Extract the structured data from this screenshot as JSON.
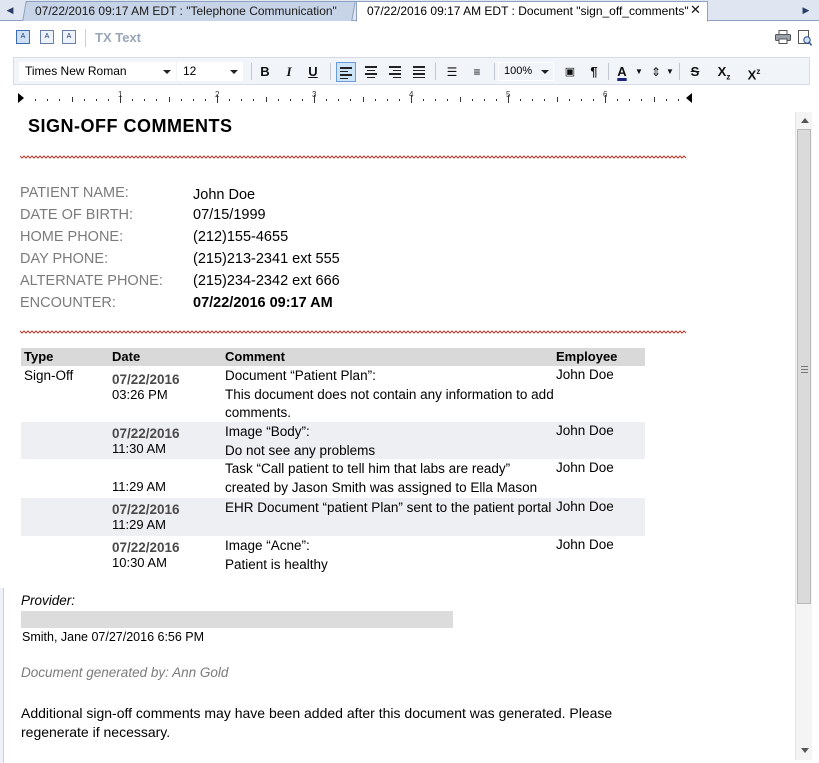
{
  "tabs": [
    {
      "label": "07/22/2016 09:17 AM EDT : \"Telephone Communication\"",
      "active": false
    },
    {
      "label": "07/22/2016 09:17 AM EDT : Document \"sign_off_comments\"",
      "active": true
    }
  ],
  "toolbar": {
    "product_label": "TX Text"
  },
  "format": {
    "font_family": "Times New Roman",
    "font_size": "12",
    "zoom": "100%",
    "bold": "B",
    "italic": "I",
    "underline": "U",
    "pilcrow": "¶",
    "strike": "S",
    "subscript": "X",
    "subscript_mark": "z",
    "superscript": "X",
    "superscript_mark": "z"
  },
  "ruler": {
    "numbers": [
      "1",
      "2",
      "3",
      "4",
      "5",
      "6"
    ]
  },
  "document": {
    "title": "SIGN-OFF COMMENTS",
    "patient": [
      {
        "label": "PATIENT NAME:",
        "value": "John Doe"
      },
      {
        "label": "DATE OF BIRTH:",
        "value": "07/15/1999"
      },
      {
        "label": "HOME PHONE:",
        "value": "(212)155-4655"
      },
      {
        "label": "DAY PHONE:",
        "value": "(215)213-2341 ext 555"
      },
      {
        "label": "ALTERNATE PHONE:",
        "value": "(215)234-2342 ext 666"
      },
      {
        "label": "ENCOUNTER:",
        "value": "07/22/2016 09:17 AM"
      }
    ],
    "table": {
      "headers": [
        "Type",
        "Date",
        "Comment",
        "Employee"
      ],
      "rows": [
        {
          "type": "Sign-Off",
          "date": "07/22/2016",
          "time": "03:26 PM",
          "comment": "Document “Patient Plan”:\nThis document does not contain any information to add comments.",
          "employee": "John Doe"
        },
        {
          "type": "",
          "date": "07/22/2016",
          "time": "11:30 AM",
          "comment": "Image “Body”:\nDo not see any problems",
          "employee": "John Doe"
        },
        {
          "type": "",
          "date": "",
          "time": "11:29 AM",
          "comment": "Task “Call patient to tell him that labs are ready” created by Jason Smith was assigned to Ella Mason",
          "employee": "John Doe"
        },
        {
          "type": "",
          "date": "07/22/2016",
          "time": "11:29 AM",
          "comment": "EHR Document “patient Plan” sent to the patient portal",
          "employee": "John Doe"
        },
        {
          "type": "",
          "date": "07/22/2016",
          "time": "10:30 AM",
          "comment": "Image “Acne”:\nPatient is healthy",
          "employee": "John Doe"
        }
      ]
    },
    "provider_label": "Provider:",
    "provider_signature": "Smith, Jane  07/27/2016 6:56 PM",
    "generated_by": "Document generated by:  Ann Gold",
    "note": "Additional sign-off comments may have been added after this document was generated. Please regenerate if necessary."
  }
}
